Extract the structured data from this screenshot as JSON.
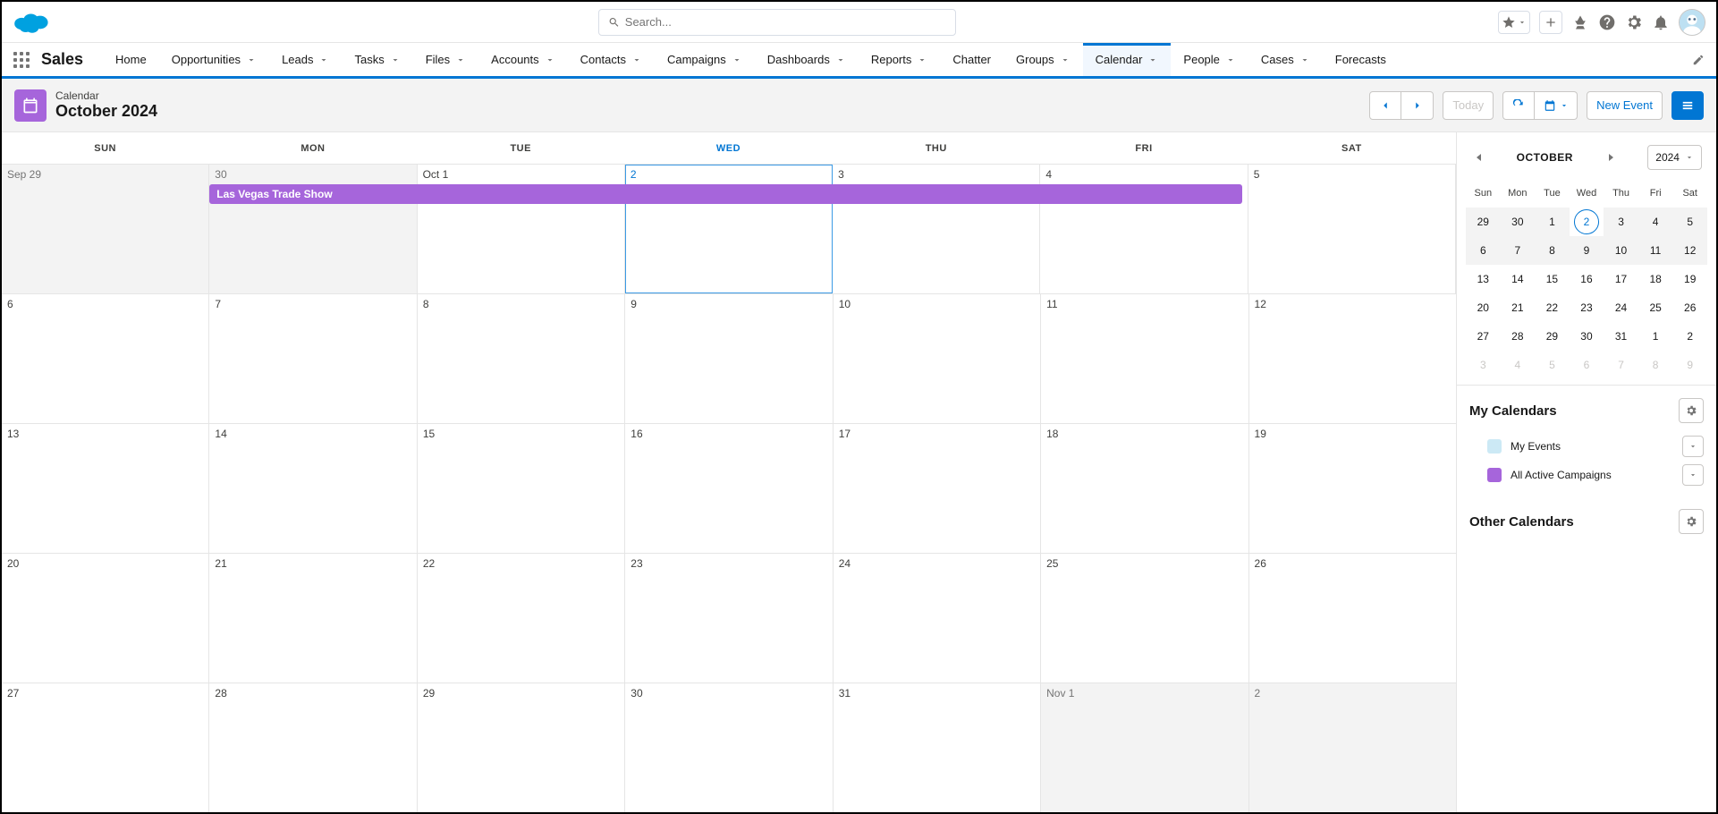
{
  "search_placeholder": "Search...",
  "app_name": "Sales",
  "nav": [
    {
      "label": "Home",
      "drop": false
    },
    {
      "label": "Opportunities",
      "drop": true
    },
    {
      "label": "Leads",
      "drop": true
    },
    {
      "label": "Tasks",
      "drop": true
    },
    {
      "label": "Files",
      "drop": true
    },
    {
      "label": "Accounts",
      "drop": true
    },
    {
      "label": "Contacts",
      "drop": true
    },
    {
      "label": "Campaigns",
      "drop": true
    },
    {
      "label": "Dashboards",
      "drop": true
    },
    {
      "label": "Reports",
      "drop": true
    },
    {
      "label": "Chatter",
      "drop": false
    },
    {
      "label": "Groups",
      "drop": true
    },
    {
      "label": "Calendar",
      "drop": true,
      "active": true
    },
    {
      "label": "People",
      "drop": true
    },
    {
      "label": "Cases",
      "drop": true
    },
    {
      "label": "Forecasts",
      "drop": false
    }
  ],
  "page": {
    "label": "Calendar",
    "title": "October 2024",
    "today_btn": "Today",
    "new_event_btn": "New Event"
  },
  "dow": [
    "SUN",
    "MON",
    "TUE",
    "WED",
    "THU",
    "FRI",
    "SAT"
  ],
  "today_dow_index": 3,
  "event": {
    "title": "Las Vegas Trade Show",
    "color": "#a665db"
  },
  "weeks": [
    [
      {
        "t": "Sep 29",
        "o": true
      },
      {
        "t": "30",
        "o": true
      },
      {
        "t": "Oct 1"
      },
      {
        "t": "2",
        "today": true
      },
      {
        "t": "3"
      },
      {
        "t": "4"
      },
      {
        "t": "5"
      }
    ],
    [
      {
        "t": "6"
      },
      {
        "t": "7"
      },
      {
        "t": "8"
      },
      {
        "t": "9"
      },
      {
        "t": "10"
      },
      {
        "t": "11"
      },
      {
        "t": "12"
      }
    ],
    [
      {
        "t": "13"
      },
      {
        "t": "14"
      },
      {
        "t": "15"
      },
      {
        "t": "16"
      },
      {
        "t": "17"
      },
      {
        "t": "18"
      },
      {
        "t": "19"
      }
    ],
    [
      {
        "t": "20"
      },
      {
        "t": "21"
      },
      {
        "t": "22"
      },
      {
        "t": "23"
      },
      {
        "t": "24"
      },
      {
        "t": "25"
      },
      {
        "t": "26"
      }
    ],
    [
      {
        "t": "27"
      },
      {
        "t": "28"
      },
      {
        "t": "29"
      },
      {
        "t": "30"
      },
      {
        "t": "31"
      },
      {
        "t": "Nov 1",
        "o": true
      },
      {
        "t": "2",
        "o": true
      }
    ]
  ],
  "mini": {
    "month": "OCTOBER",
    "year": "2024",
    "dow": [
      "Sun",
      "Mon",
      "Tue",
      "Wed",
      "Thu",
      "Fri",
      "Sat"
    ],
    "rows": [
      [
        {
          "t": "29",
          "s": true
        },
        {
          "t": "30",
          "s": true
        },
        {
          "t": "1",
          "s": true
        },
        {
          "t": "2",
          "s": true,
          "today": true
        },
        {
          "t": "3",
          "s": true
        },
        {
          "t": "4",
          "s": true
        },
        {
          "t": "5",
          "s": true
        }
      ],
      [
        {
          "t": "6",
          "s": true
        },
        {
          "t": "7",
          "s": true
        },
        {
          "t": "8",
          "s": true
        },
        {
          "t": "9",
          "s": true
        },
        {
          "t": "10",
          "s": true
        },
        {
          "t": "11",
          "s": true
        },
        {
          "t": "12",
          "s": true
        }
      ],
      [
        {
          "t": "13"
        },
        {
          "t": "14"
        },
        {
          "t": "15"
        },
        {
          "t": "16"
        },
        {
          "t": "17"
        },
        {
          "t": "18"
        },
        {
          "t": "19"
        }
      ],
      [
        {
          "t": "20"
        },
        {
          "t": "21"
        },
        {
          "t": "22"
        },
        {
          "t": "23"
        },
        {
          "t": "24"
        },
        {
          "t": "25"
        },
        {
          "t": "26"
        }
      ],
      [
        {
          "t": "27"
        },
        {
          "t": "28"
        },
        {
          "t": "29"
        },
        {
          "t": "30"
        },
        {
          "t": "31"
        },
        {
          "t": "1"
        },
        {
          "t": "2"
        }
      ],
      [
        {
          "t": "3",
          "other": true
        },
        {
          "t": "4",
          "other": true
        },
        {
          "t": "5",
          "other": true
        },
        {
          "t": "6",
          "other": true
        },
        {
          "t": "7",
          "other": true
        },
        {
          "t": "8",
          "other": true
        },
        {
          "t": "9",
          "other": true
        }
      ]
    ]
  },
  "my_calendars": {
    "title": "My Calendars",
    "items": [
      {
        "label": "My Events",
        "color": "#cce9f5"
      },
      {
        "label": "All Active Campaigns",
        "color": "#a665db"
      }
    ]
  },
  "other_calendars": {
    "title": "Other Calendars"
  }
}
